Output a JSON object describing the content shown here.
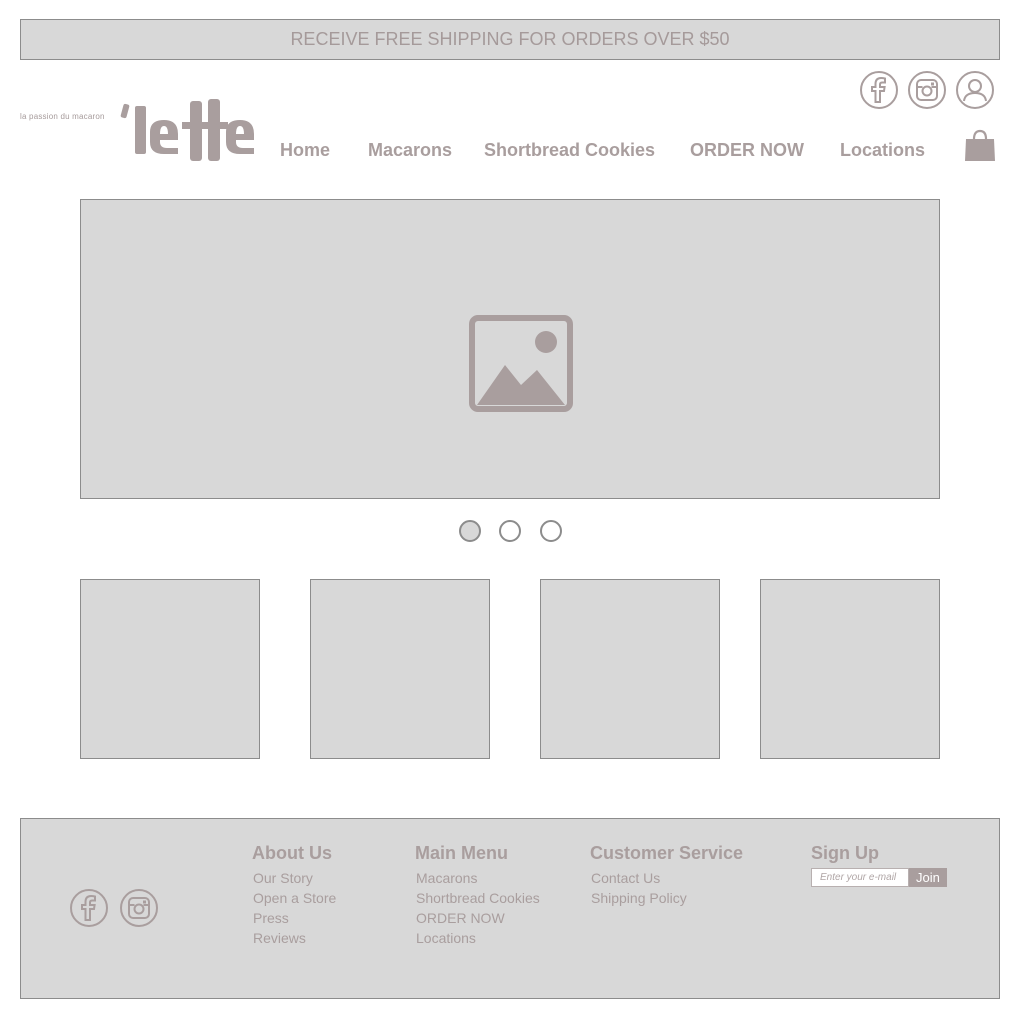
{
  "banner": {
    "text": "RECEIVE FREE SHIPPING FOR ORDERS OVER $50"
  },
  "logo": {
    "tagline": "la passion du macaron",
    "wordmark": "'lette"
  },
  "header_icons": [
    "facebook-icon",
    "instagram-icon",
    "user-account-icon",
    "shopping-bag-icon"
  ],
  "nav": {
    "items": [
      "Home",
      "Macarons",
      "Shortbread Cookies",
      "ORDER NOW",
      "Locations"
    ]
  },
  "carousel": {
    "slide_count": 3,
    "active_index": 0,
    "placeholder_icon": "image-placeholder-icon"
  },
  "footer": {
    "columns": [
      {
        "title": "About Us",
        "links": [
          "Our Story",
          "Open a Store",
          "Press",
          "Reviews"
        ]
      },
      {
        "title": "Main Menu",
        "links": [
          "Macarons",
          "Shortbread Cookies",
          "ORDER NOW",
          "Locations"
        ]
      },
      {
        "title": "Customer Service",
        "links": [
          "Contact Us",
          "Shipping Policy"
        ]
      }
    ],
    "signup": {
      "title": "Sign Up",
      "placeholder": "Enter your e-mail",
      "button_label": "Join"
    },
    "social_icons": [
      "facebook-icon",
      "instagram-icon"
    ]
  },
  "colors": {
    "accent": "#a99e9e",
    "placeholder_fill": "#d8d8d8",
    "border": "#8c8c8c"
  }
}
